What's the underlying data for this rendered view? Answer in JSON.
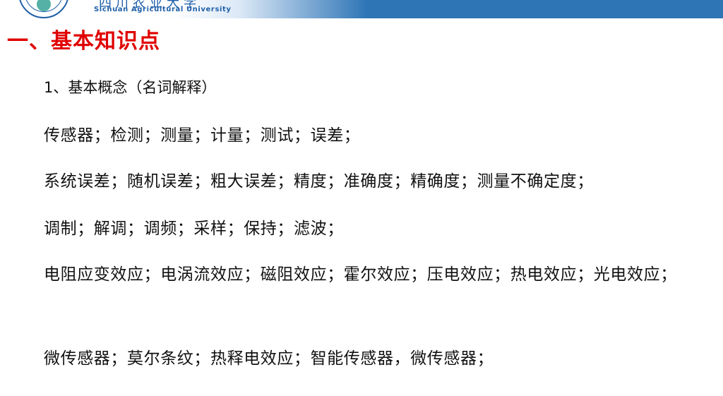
{
  "header": {
    "university_name_cn": "四川农业大学",
    "university_name_en": "Sichuan Agricultural University",
    "colors": {
      "band_blue": "#2e75b6",
      "logo_blue": "#1f5fa8"
    }
  },
  "section": {
    "title": "一、基本知识点",
    "title_color": "#e00000"
  },
  "content": {
    "subtitle": "1、基本概念（名词解释）",
    "lines": [
      "传感器；检测；测量；计量；测试；误差；",
      "系统误差；随机误差；粗大误差；精度；准确度；精确度；测量不确定度；",
      "调制；解调；调频；采样；保持；滤波；",
      "电阻应变效应；电涡流效应；磁阻效应；霍尔效应；压电效应；热电效应；光电效应；",
      "微传感器；莫尔条纹；热释电效应；智能传感器，微传感器；"
    ]
  }
}
